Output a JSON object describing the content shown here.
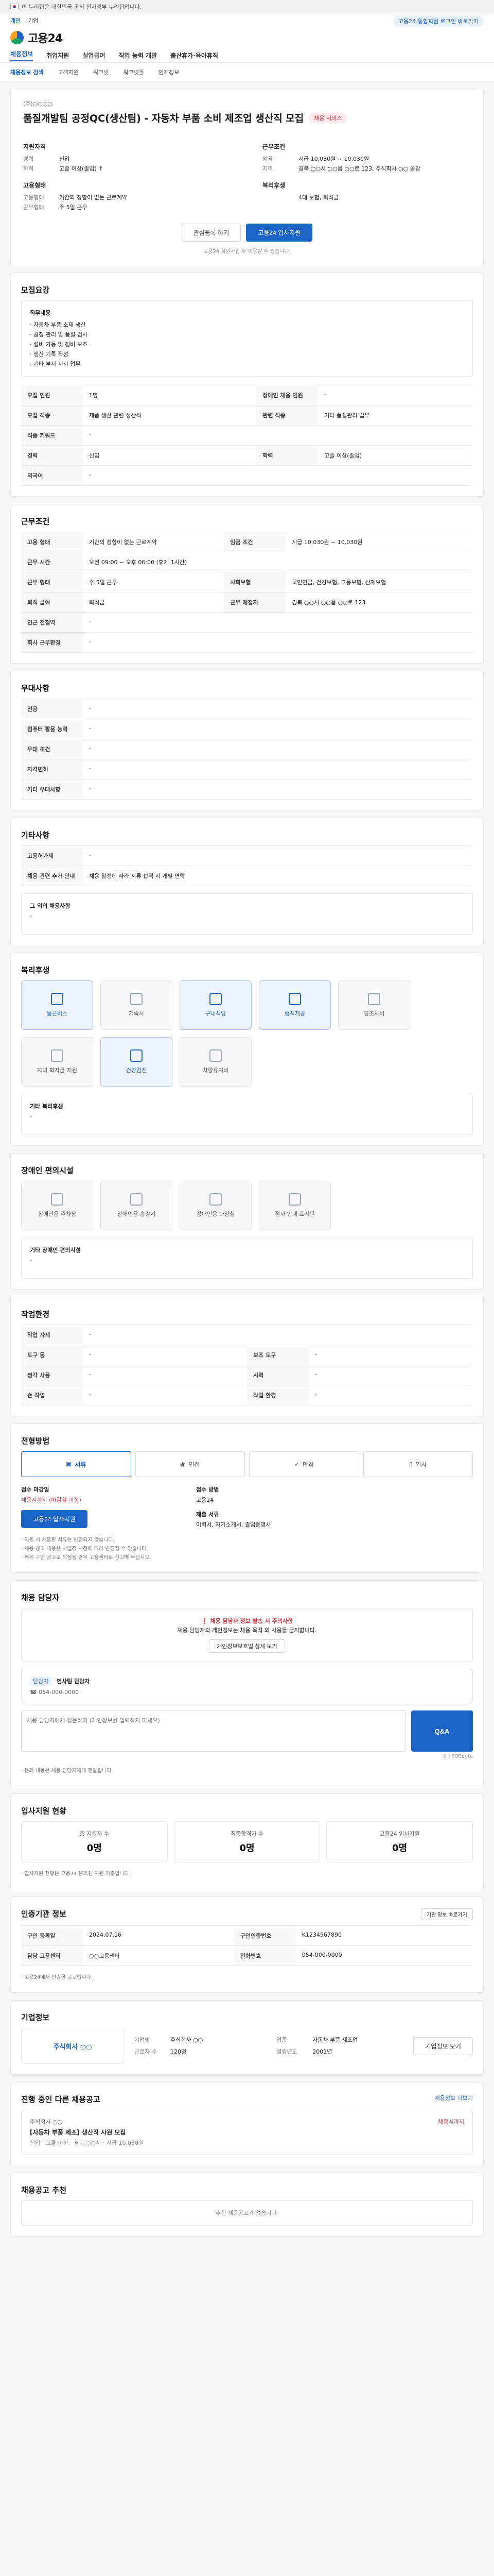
{
  "gov": {
    "text": "이 누리집은 대한민국 공식 전자정부 누리집입니다."
  },
  "header": {
    "lang": [
      "개인",
      "기업"
    ],
    "login": "고용24 통합회원 로그인 바로가기",
    "logo": "고용24",
    "gnb": [
      "채용정보",
      "취업지원",
      "실업급여",
      "직업 능력 개발",
      "출산휴가·육아휴직"
    ]
  },
  "subnav": [
    "채용정보 검색",
    "고객지원",
    "워크넷",
    "워크넷몰",
    "인재정보"
  ],
  "job": {
    "company_line": "(주)○○○○",
    "title": "품질개발팀 공정QC(생산팀) - 자동차 부품 소비 제조업 생산직 모집",
    "badge": "채용 서비스",
    "left_h": "지원자격",
    "left": [
      {
        "k": "경력",
        "v": "신입"
      },
      {
        "k": "학력",
        "v": "고졸 이상(졸업) ↑"
      }
    ],
    "left_h2": "고용형태",
    "left2": [
      {
        "k": "고용형태",
        "v": "기간의 정함이 없는 근로계약"
      },
      {
        "k": "근무형태",
        "v": "주 5일 근무"
      }
    ],
    "right_h": "근무조건",
    "right": [
      {
        "k": "임금",
        "v": "시급 10,030원 ~ 10,030원"
      },
      {
        "k": "지역",
        "v": "경북 ○○시 ○○읍 ○○로 123, 주식회사 ○○ 공장"
      }
    ],
    "right_h2": "복리후생",
    "right2": [
      {
        "k": "",
        "v": "4대 보험, 퇴직금"
      }
    ],
    "btn_save": "관심등록 하기",
    "btn_apply": "고용24 입사지원",
    "note": "고용24 회원가입 후 이용할 수 있습니다."
  },
  "sec_job": {
    "title": "모집요강",
    "desc_h": "직무내용",
    "desc": [
      "· 자동차 부품 소재 생산",
      "· 공정 관리 및 품질 검사",
      "· 설비 가동 및 정비 보조",
      "· 생산 기록 작성",
      "· 기타 부서 지시 업무"
    ],
    "rows": [
      {
        "k": "모집 인원",
        "v": "1명",
        "k2": "장애인 채용 인원",
        "v2": "-"
      },
      {
        "k": "모집 직종",
        "v": "제품 생산 관련 생산직",
        "k2": "관련 직종",
        "v2": "기타 품질관리 업무"
      },
      {
        "k": "직종 키워드",
        "v": "-",
        "k2": "",
        "v2": ""
      },
      {
        "k": "경력",
        "v": "신입",
        "k2": "학력",
        "v2": "고졸 이상(졸업)"
      },
      {
        "k": "외국어",
        "v": "-",
        "k2": "",
        "v2": ""
      }
    ]
  },
  "sec_cond": {
    "title": "근무조건",
    "rows": [
      {
        "k": "고용 형태",
        "v": "기간의 정함이 없는 근로계약",
        "k2": "임금 조건",
        "v2": "시급 10,030원 ~ 10,030원"
      },
      {
        "k": "근무 시간",
        "v": "오전 09:00 ~ 오후 06:00 (휴게 1시간)",
        "k2": "",
        "v2": ""
      },
      {
        "k": "근무 형태",
        "v": "주 5일 근무",
        "k2": "사회보험",
        "v2": "국민연금, 건강보험, 고용보험, 산재보험"
      },
      {
        "k": "퇴직 급여",
        "v": "퇴직금",
        "k2": "근무 예정지",
        "v2": "경북 ○○시 ○○읍 ○○로 123"
      },
      {
        "k": "인근 전철역",
        "v": "-",
        "k2": "",
        "v2": ""
      },
      {
        "k": "회사 근무환경",
        "v": "-",
        "k2": "",
        "v2": ""
      }
    ]
  },
  "sec_pref": {
    "title": "우대사항",
    "rows": [
      {
        "k": "전공",
        "v": "-"
      },
      {
        "k": "컴퓨터 활용 능력",
        "v": "-"
      },
      {
        "k": "우대 조건",
        "v": "-"
      },
      {
        "k": "자격면허",
        "v": "-"
      },
      {
        "k": "기타 우대사항",
        "v": "-"
      }
    ]
  },
  "sec_etc": {
    "title": "기타사항",
    "rows": [
      {
        "k": "고용허가제",
        "v": "-"
      },
      {
        "k": "채용 관련 추가 안내",
        "v": "채용 일정에 따라 서류 합격 시 개별 연락"
      }
    ],
    "box_h": "그 외의 채용사항",
    "box_v": "-"
  },
  "sec_welfare": {
    "title": "복리후생",
    "tiles": [
      "통근버스",
      "기숙사",
      "구내식당",
      "중식제공",
      "경조사비",
      "자녀 학자금 지원",
      "건강검진",
      "차량유지비"
    ],
    "box_h": "기타 복리후생",
    "box_v": "-"
  },
  "sec_disab": {
    "title": "장애인 편의시설",
    "tiles": [
      "장애인용 주차장",
      "장애인용 승강기",
      "장애인용 화장실",
      "점자 안내 표지판"
    ],
    "box_h": "기타 장애인 편의시설",
    "box_v": "-"
  },
  "sec_place": {
    "title": "작업환경",
    "rows": [
      {
        "k": "작업 자세",
        "v": "-",
        "k2": "",
        "v2": ""
      },
      {
        "k": "도구 등",
        "v": "-",
        "k2": "보조 도구",
        "v2": "-"
      },
      {
        "k": "청각 사용",
        "v": "-",
        "k2": "시력",
        "v2": "-"
      },
      {
        "k": "손 작업",
        "v": "-",
        "k2": "작업 환경",
        "v2": "-"
      }
    ]
  },
  "sec_proc": {
    "title": "전형방법",
    "steps": [
      "서류",
      "면접",
      "합격",
      "입사"
    ],
    "how_h1": "접수 마감일",
    "how_v1": "채용시까지 (마감일 미정)",
    "how_h2": "접수 방법",
    "how_v2": "고용24",
    "how_h3": "제출 서류",
    "how_v3": "이력서, 자기소개서, 졸업증명서",
    "apply_btn": "고용24 입사지원",
    "bullets": [
      "· 지원 시 제출한 서류는 반환되지 않습니다.",
      "· 채용 공고 내용은 사업장 사정에 따라 변경될 수 있습니다.",
      "· 허위 구인 광고로 의심될 경우 고용센터로 신고해 주십시오."
    ]
  },
  "sec_mgr": {
    "title": "채용 담당자",
    "warn": "채용 담당자 정보 발송 시 주의사항",
    "notice": "채용 담당자의 개인정보는 채용 목적 외 사용을 금지합니다.",
    "notice_btn": "개인정보보호법 상세 보기",
    "mgr_tag": "담당자",
    "mgr_name": "인사팀 담당자",
    "mgr_tel": "054-000-0000",
    "qna_placeholder": "채용 담당자에게 질문하기 (개인정보를 입력하지 마세요)",
    "qna_btn": "Q&A",
    "qna_count": "0 / 500byte",
    "qna_note": "· 문의 내용은 채용 담당자에게 전달됩니다."
  },
  "sec_stat": {
    "title": "입사지원 현황",
    "items": [
      {
        "label": "총 지원자 수",
        "value": "0명"
      },
      {
        "label": "최종합격자 수",
        "value": "0명"
      },
      {
        "label": "고용24 입사지원",
        "value": "0명"
      }
    ],
    "note": "· 입사지원 현황은 고용24 온라인 지원 기준입니다."
  },
  "sec_info": {
    "title": "인증기관 정보",
    "btn": "기관 정보 바로가기",
    "rows": [
      {
        "k": "구인 등록일",
        "v": "2024.07.16",
        "k2": "구인인증번호",
        "v2": "K1234567890"
      },
      {
        "k": "담당 고용센터",
        "v": "○○고용센터",
        "k2": "전화번호",
        "v2": "054-000-0000"
      }
    ],
    "note": "· 고용24에서 인증한 공고입니다."
  },
  "sec_co": {
    "title": "기업정보",
    "logo": "주식회사 ○○",
    "info": [
      {
        "k": "기업명",
        "v": "주식회사 ○○"
      },
      {
        "k": "업종",
        "v": "자동차 부품 제조업"
      },
      {
        "k": "근로자 수",
        "v": "120명"
      },
      {
        "k": "설립년도",
        "v": "2001년"
      }
    ],
    "btn": "기업정보 보기"
  },
  "sec_other": {
    "title": "진행 중인 다른 채용공고",
    "more": "채용정보 더보기",
    "item_company": "주식회사 ○○",
    "item_title": "[자동차 부품 제조] 생산직 사원 모집",
    "item_meta": "신입 · 고졸 이상 · 경북 ○○시 · 시급 10,030원",
    "item_dday": "채용시까지"
  },
  "sec_view": {
    "title": "채용공고 추천",
    "empty": "추천 채용공고가 없습니다."
  }
}
